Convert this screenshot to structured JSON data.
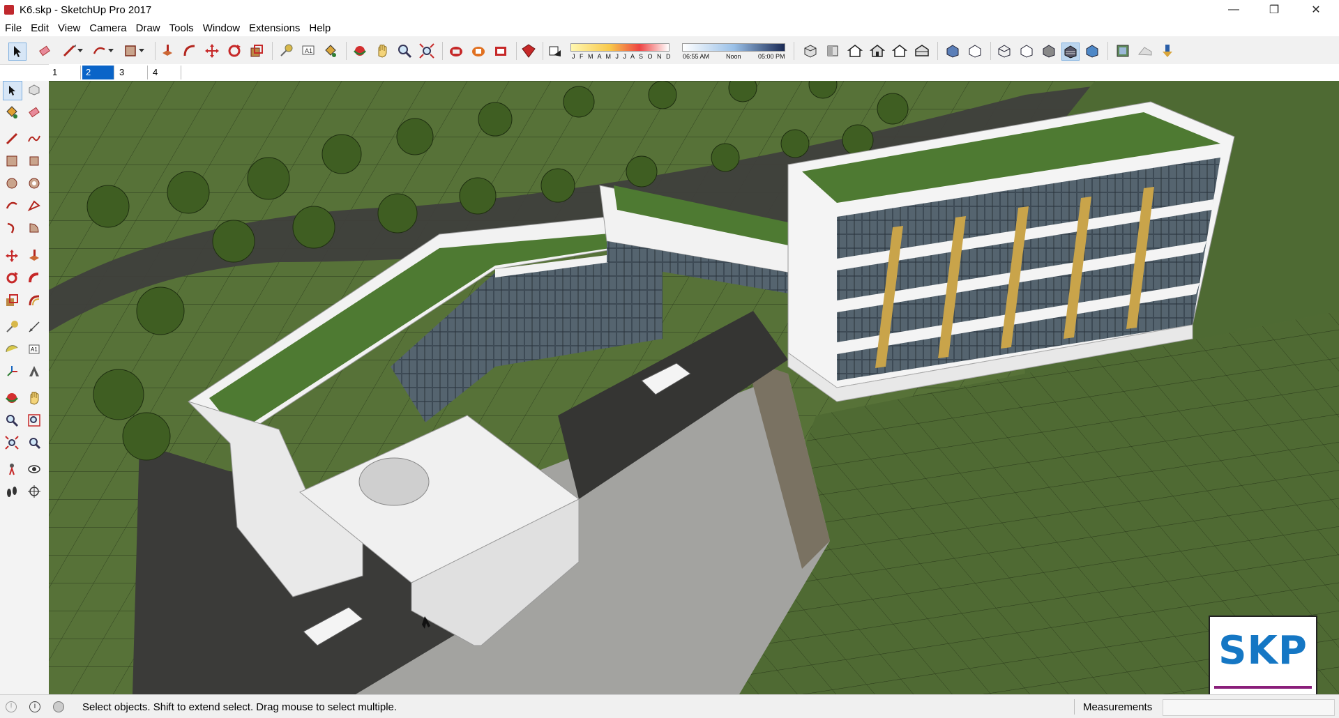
{
  "window": {
    "title": "K6.skp - SketchUp Pro 2017",
    "minimize_glyph": "—",
    "restore_glyph": "❐",
    "close_glyph": "✕"
  },
  "menu": [
    "File",
    "Edit",
    "View",
    "Camera",
    "Draw",
    "Tools",
    "Window",
    "Extensions",
    "Help"
  ],
  "shadows": {
    "months": "J F M A M J J A S O N D",
    "time_start": "06:55 AM",
    "time_mid": "Noon",
    "time_end": "05:00 PM"
  },
  "scenes": {
    "tabs": [
      "1",
      "2",
      "3",
      "4"
    ],
    "active_index": 1
  },
  "status": {
    "message": "Select objects. Shift to extend select. Drag mouse to select multiple.",
    "measurements_label": "Measurements",
    "measurements_value": ""
  },
  "logo": {
    "text": "SKP"
  },
  "colors": {
    "accent": "#0a64c8",
    "grass": "#5d7a3e",
    "roof_green": "#4e7a32",
    "road": "#3a3a3a",
    "building_white": "#f2f2f2",
    "glass": "#3a4a55",
    "wood": "#c9a44a",
    "logo_blue": "#1577c4"
  }
}
